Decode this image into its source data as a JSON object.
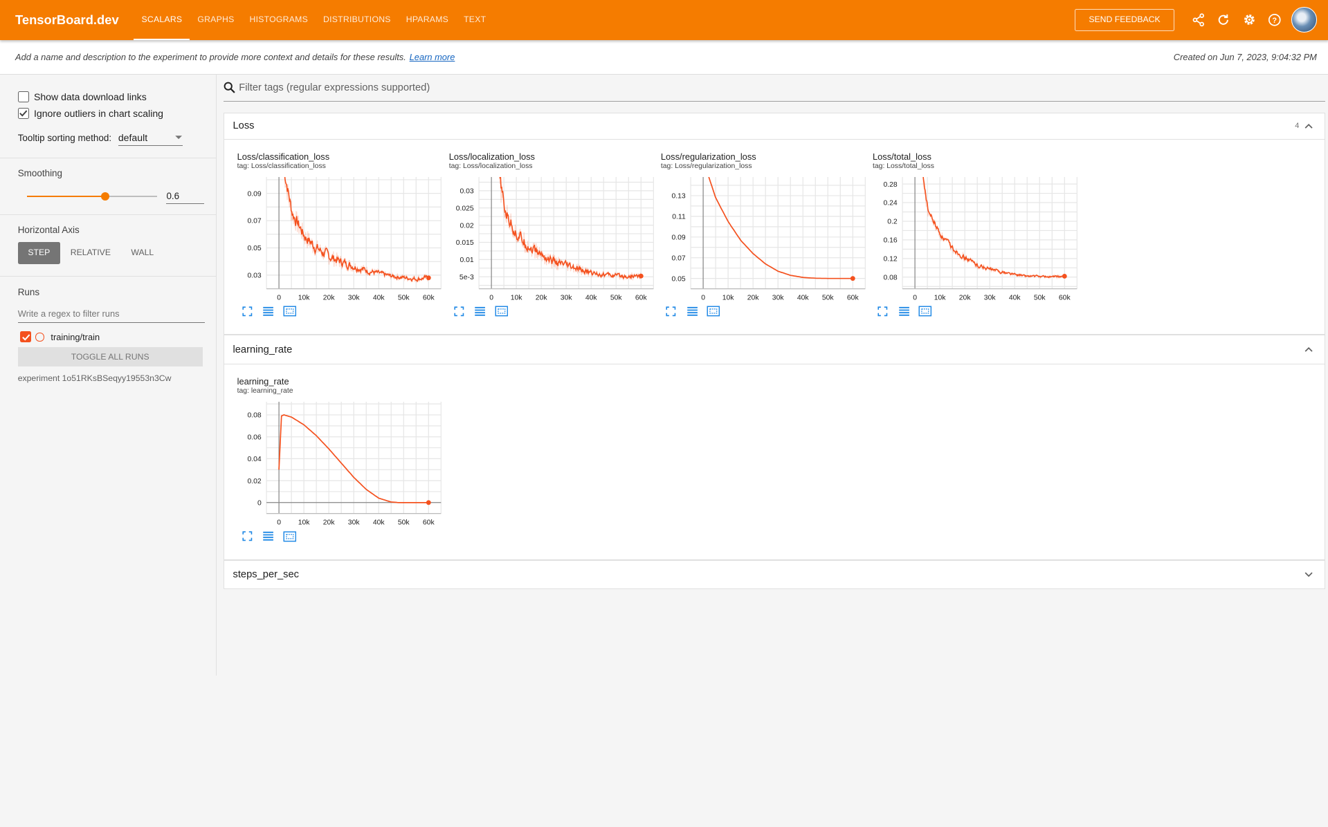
{
  "header": {
    "brand": "TensorBoard.dev",
    "tabs": [
      "SCALARS",
      "GRAPHS",
      "HISTOGRAMS",
      "DISTRIBUTIONS",
      "HPARAMS",
      "TEXT"
    ],
    "active_tab": "SCALARS",
    "feedback_label": "SEND FEEDBACK",
    "icons": [
      "share-icon",
      "refresh-icon",
      "settings-icon",
      "help-icon"
    ]
  },
  "description": {
    "text": "Add a name and description to the experiment to provide more context and details for these results.",
    "link": "Learn more",
    "created": "Created on Jun 7, 2023, 9:04:32 PM"
  },
  "sidebar": {
    "show_download_label": "Show data download links",
    "show_download_checked": false,
    "ignore_outliers_label": "Ignore outliers in chart scaling",
    "ignore_outliers_checked": true,
    "tooltip_label": "Tooltip sorting method:",
    "tooltip_value": "default",
    "smoothing_title": "Smoothing",
    "smoothing_value": "0.6",
    "smoothing_fraction": 0.6,
    "axis_title": "Horizontal Axis",
    "axis_options": [
      "STEP",
      "RELATIVE",
      "WALL"
    ],
    "axis_selected": "STEP",
    "runs_title": "Runs",
    "runs_filter_placeholder": "Write a regex to filter runs",
    "run_name": "training/train",
    "toggle_all_label": "TOGGLE ALL RUNS",
    "experiment": "experiment 1o51RKsBSeqyy19553n3Cw"
  },
  "main": {
    "filter_placeholder": "Filter tags (regular expressions supported)",
    "groups": [
      {
        "name": "Loss",
        "count": "4",
        "expanded": true
      },
      {
        "name": "learning_rate",
        "count": "",
        "expanded": true
      },
      {
        "name": "steps_per_sec",
        "count": "",
        "expanded": false
      }
    ]
  },
  "colors": {
    "accent": "#f57c00",
    "run": "#f4511e",
    "icon": "#1e88e5"
  },
  "chart_data": [
    {
      "type": "line",
      "title": "Loss/classification_loss",
      "tag": "tag: Loss/classification_loss",
      "x_ticks": [
        "0",
        "10k",
        "20k",
        "30k",
        "40k",
        "50k",
        "60k"
      ],
      "y_ticks": [
        "0.03",
        "0.05",
        "0.07",
        "0.09"
      ],
      "y_tick_values": [
        0.03,
        0.05,
        0.07,
        0.09
      ],
      "xlim": [
        -5000,
        65000
      ],
      "ylim": [
        0.02,
        0.102
      ],
      "x": [
        2000,
        5000,
        10000,
        15000,
        20000,
        25000,
        30000,
        35000,
        40000,
        45000,
        50000,
        55000,
        60000
      ],
      "y": [
        0.105,
        0.075,
        0.058,
        0.049,
        0.043,
        0.039,
        0.036,
        0.033,
        0.031,
        0.029,
        0.028,
        0.027,
        0.028
      ],
      "noise": 0.0045
    },
    {
      "type": "line",
      "title": "Loss/localization_loss",
      "tag": "tag: Loss/localization_loss",
      "x_ticks": [
        "0",
        "10k",
        "20k",
        "30k",
        "40k",
        "50k",
        "60k"
      ],
      "y_ticks": [
        "5e-3",
        "0.01",
        "0.015",
        "0.02",
        "0.025",
        "0.03"
      ],
      "y_tick_values": [
        0.005,
        0.01,
        0.015,
        0.02,
        0.025,
        0.03
      ],
      "xlim": [
        -5000,
        65000
      ],
      "ylim": [
        0.0015,
        0.034
      ],
      "x": [
        3000,
        5000,
        10000,
        15000,
        20000,
        25000,
        30000,
        35000,
        40000,
        45000,
        50000,
        55000,
        60000
      ],
      "y": [
        0.034,
        0.024,
        0.017,
        0.0135,
        0.011,
        0.009,
        0.0078,
        0.0068,
        0.006,
        0.0055,
        0.0052,
        0.005,
        0.0052
      ],
      "noise": 0.0018
    },
    {
      "type": "line",
      "title": "Loss/regularization_loss",
      "tag": "tag: Loss/regularization_loss",
      "x_ticks": [
        "0",
        "10k",
        "20k",
        "30k",
        "40k",
        "50k",
        "60k"
      ],
      "y_ticks": [
        "0.05",
        "0.07",
        "0.09",
        "0.11",
        "0.13"
      ],
      "y_tick_values": [
        0.05,
        0.07,
        0.09,
        0.11,
        0.13
      ],
      "xlim": [
        -5000,
        65000
      ],
      "ylim": [
        0.04,
        0.148
      ],
      "x": [
        2000,
        5000,
        10000,
        15000,
        20000,
        25000,
        30000,
        35000,
        40000,
        45000,
        50000,
        55000,
        60000
      ],
      "y": [
        0.15,
        0.128,
        0.105,
        0.087,
        0.074,
        0.064,
        0.057,
        0.053,
        0.051,
        0.0502,
        0.05,
        0.05,
        0.05
      ],
      "noise": 0
    },
    {
      "type": "line",
      "title": "Loss/total_loss",
      "tag": "tag: Loss/total_loss",
      "x_ticks": [
        "0",
        "10k",
        "20k",
        "30k",
        "40k",
        "50k",
        "60k"
      ],
      "y_ticks": [
        "0.08",
        "0.12",
        "0.16",
        "0.2",
        "0.24",
        "0.28"
      ],
      "y_tick_values": [
        0.08,
        0.12,
        0.16,
        0.2,
        0.24,
        0.28
      ],
      "xlim": [
        -5000,
        65000
      ],
      "ylim": [
        0.055,
        0.295
      ],
      "x": [
        3000,
        5000,
        10000,
        15000,
        20000,
        25000,
        30000,
        35000,
        40000,
        45000,
        50000,
        55000,
        60000
      ],
      "y": [
        0.3,
        0.22,
        0.17,
        0.14,
        0.12,
        0.105,
        0.096,
        0.09,
        0.085,
        0.082,
        0.081,
        0.08,
        0.082
      ],
      "noise": 0.006
    },
    {
      "type": "line",
      "title": "learning_rate",
      "tag": "tag: learning_rate",
      "x_ticks": [
        "0",
        "10k",
        "20k",
        "30k",
        "40k",
        "50k",
        "60k"
      ],
      "y_ticks": [
        "0",
        "0.02",
        "0.04",
        "0.06",
        "0.08"
      ],
      "y_tick_values": [
        0,
        0.02,
        0.04,
        0.06,
        0.08
      ],
      "xlim": [
        -5000,
        65000
      ],
      "ylim": [
        -0.01,
        0.092
      ],
      "x": [
        0,
        1000,
        2000,
        5000,
        10000,
        15000,
        20000,
        25000,
        30000,
        35000,
        40000,
        45000,
        48000,
        50000,
        55000,
        60000
      ],
      "y": [
        0.03,
        0.079,
        0.08,
        0.078,
        0.071,
        0.061,
        0.049,
        0.036,
        0.023,
        0.012,
        0.004,
        0.0005,
        0,
        0,
        0,
        0
      ],
      "noise": 0
    }
  ]
}
